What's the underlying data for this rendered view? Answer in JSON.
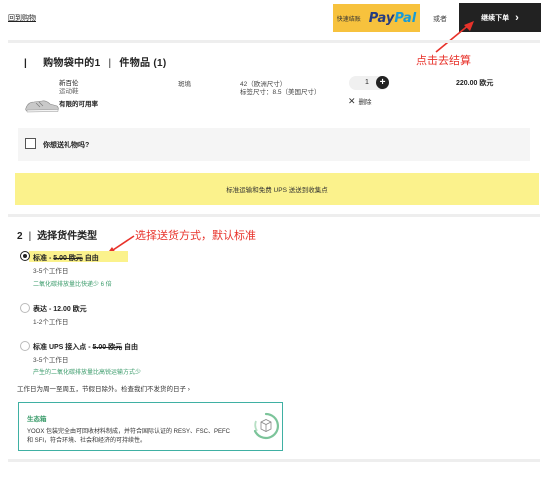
{
  "header": {
    "back_link": "回到购物",
    "paypal_prefix": "快速结账",
    "paypal_word_1": "Pay",
    "paypal_word_2": "Pal",
    "or_text": "或者",
    "checkout_label": "继续下单",
    "checkout_chevron": "›"
  },
  "annotations": {
    "checkout": "点击去结算",
    "shipping": "选择送货方式，默认标准"
  },
  "bag": {
    "title_prefix": "|",
    "title_count_label": "购物袋中的1",
    "title_sep": "|",
    "title_items": "件物品 (1)",
    "product": {
      "name": "新百伦",
      "type": "运动鞋",
      "stock_note": "有限的可用率",
      "color": "斑塢",
      "size": "42（欧洲尺寸）",
      "size_us": "标签尺寸：8.5（美国尺寸）",
      "quantity": "1",
      "plus": "+",
      "remove_icon": "✕",
      "remove_label": "删除",
      "price": "220.00 欧元"
    },
    "gift_label": "你想送礼物吗?"
  },
  "banner": {
    "text": "标准运输和免费 UPS 送送到收集点"
  },
  "shipping": {
    "step": "2",
    "sep": "|",
    "title": "选择货件类型",
    "options": [
      {
        "label_prefix": "标准 - ",
        "label_strike": "5.00 欧元",
        "label_suffix": " 自由",
        "days": "3-5个工作日",
        "co2": "二氧化碳排放量比快递少 6 倍",
        "selected": true
      },
      {
        "label_prefix": "表达 - 12.00 欧元",
        "label_strike": "",
        "label_suffix": "",
        "days": "1-2个工作日",
        "co2": "",
        "selected": false
      },
      {
        "label_prefix": "标准 UPS 接入点 - ",
        "label_strike": "5.00 欧元",
        "label_suffix": " 自由",
        "days": "3-5个工作日",
        "co2": "产生的二氧化碳排放量比高锐运输方式少",
        "selected": false
      }
    ],
    "workdays_note": "工作日为周一至周五，节假日除外。检查我们不发货的日子 ›",
    "eco": {
      "title": "生态箱",
      "text_line1": "YOOX 包装完全由可回收材料制成，并符合国际认证的 RESY、FSC、PEFC",
      "text_line2": "和 SFI，符合环境、社会和经济的可持续性。"
    }
  },
  "colors": {
    "paypal_yellow": "#f7c23d",
    "checkout_black": "#222222",
    "banner_yellow": "#fbf28c",
    "annotation_red": "#e8322a",
    "eco_green": "#3a9b6a"
  }
}
